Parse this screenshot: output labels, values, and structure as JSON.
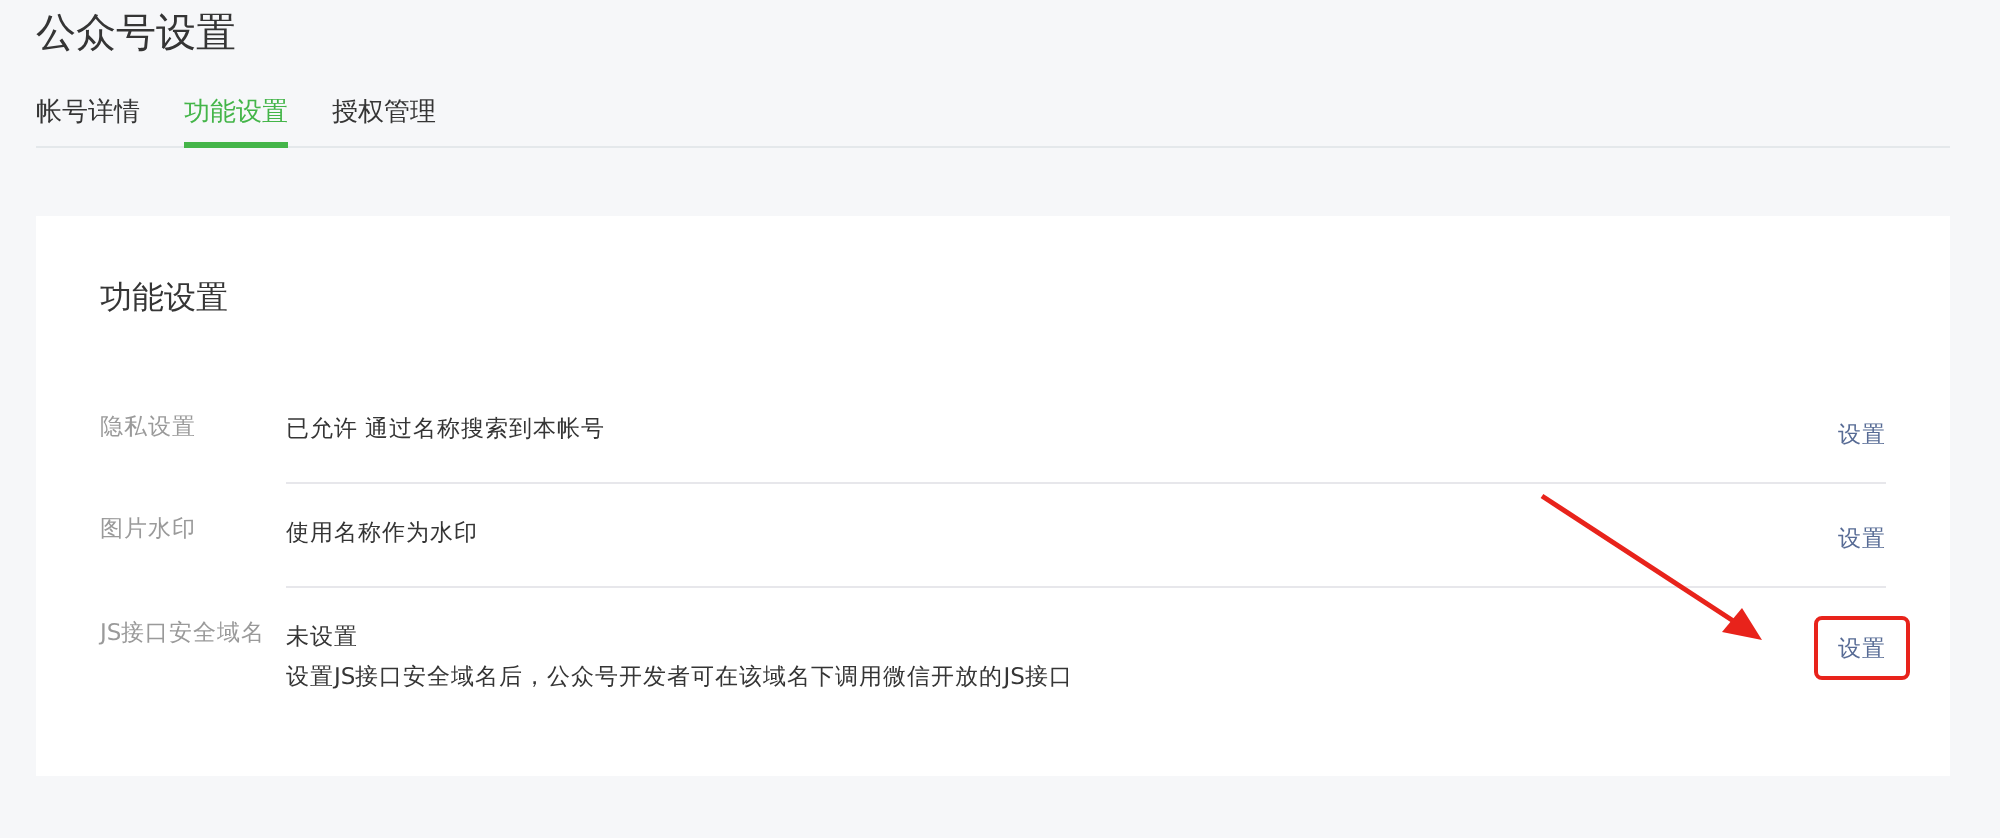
{
  "page_title": "公众号设置",
  "tabs": [
    {
      "label": "帐号详情",
      "selected": false
    },
    {
      "label": "功能设置",
      "selected": true
    },
    {
      "label": "授权管理",
      "selected": false
    }
  ],
  "card": {
    "title": "功能设置",
    "rows": [
      {
        "label": "隐私设置",
        "lines": [
          "已允许 通过名称搜索到本帐号"
        ],
        "action": "设置",
        "highlighted": false
      },
      {
        "label": "图片水印",
        "lines": [
          "使用名称作为水印"
        ],
        "action": "设置",
        "highlighted": false
      },
      {
        "label": "JS接口安全域名",
        "lines": [
          "未设置",
          "设置JS接口安全域名后，公众号开发者可在该域名下调用微信开放的JS接口"
        ],
        "action": "设置",
        "highlighted": true
      }
    ]
  }
}
